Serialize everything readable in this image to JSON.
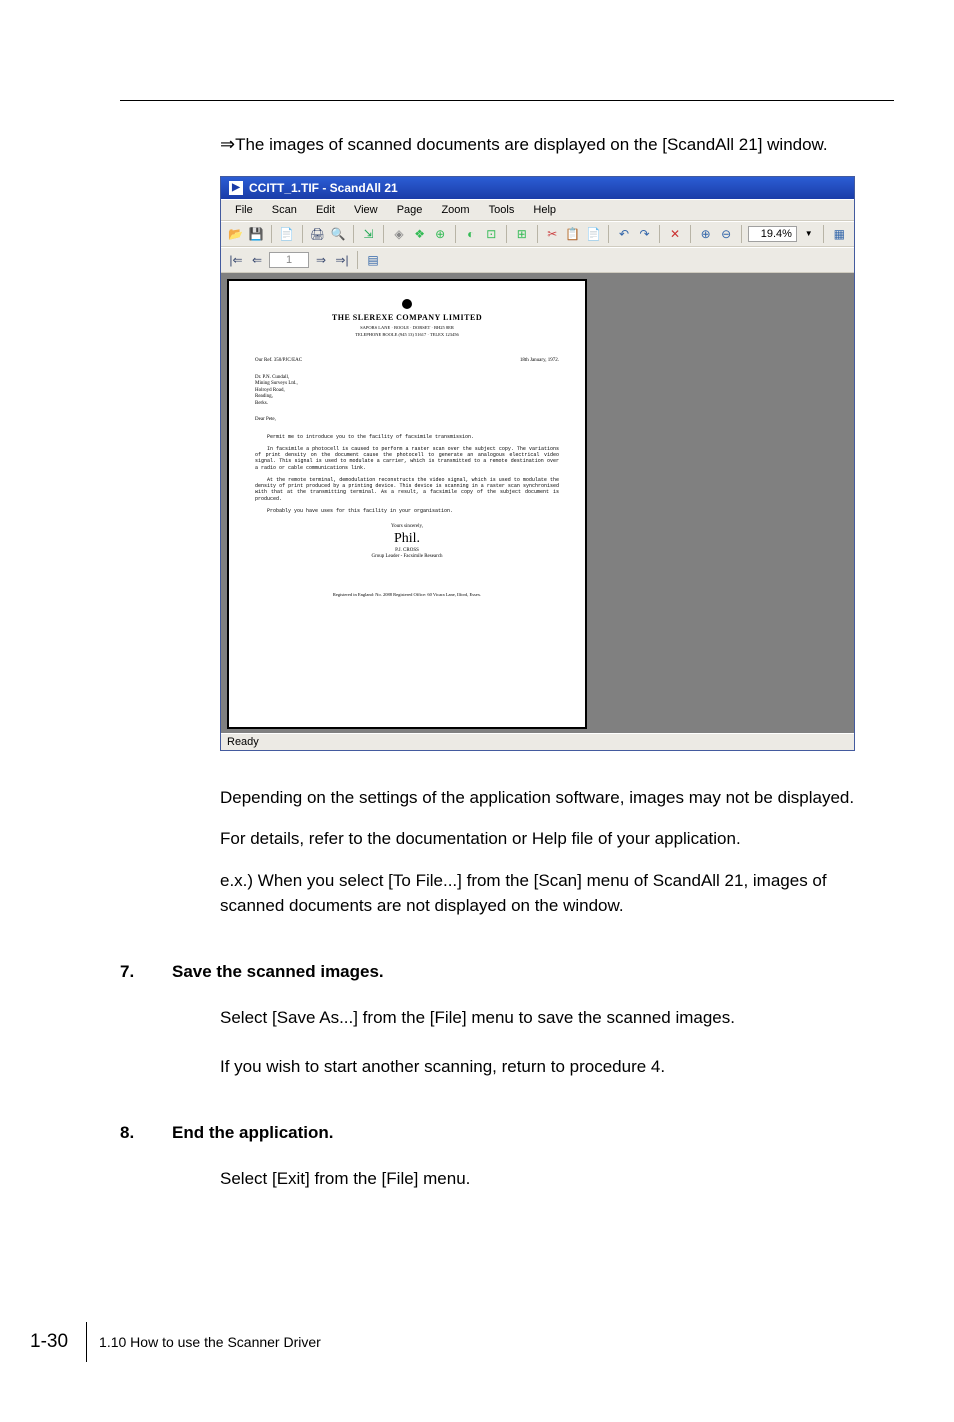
{
  "intro": "The images of scanned documents are displayed on the [ScandAll 21] window.",
  "arrow": "⇒",
  "app": {
    "title": "CCITT_1.TIF - ScandAll 21",
    "menus": [
      "File",
      "Scan",
      "Edit",
      "View",
      "Page",
      "Zoom",
      "Tools",
      "Help"
    ],
    "zoom": "19.4%",
    "page_num": "1",
    "status": "Ready",
    "doc": {
      "company": "THE SLEREXE COMPANY LIMITED",
      "sub1": "SAPORS LANE · BOOLE · DORSET · BH25 8ER",
      "sub2": "TELEPHONE BOOLE (945 13) 51617 · TELEX 123456",
      "ref": "Our Ref. 350/PJC/EAC",
      "date": "18th January, 1972.",
      "addr1": "Dr. P.N. Cundall,",
      "addr2": "Mining Surveys Ltd.,",
      "addr3": "Holroyd Road,",
      "addr4": "Reading,",
      "addr5": "Berks.",
      "saluation": "Dear Pete,",
      "p1": "Permit me to introduce you to the facility of facsimile transmission.",
      "p2": "In facsimile a photocell is caused to perform a raster scan over the subject copy. The variations of print density on the document cause the photocell to generate an analogous electrical video signal. This signal is used to modulate a carrier, which is transmitted to a remote destination over a radio or cable communications link.",
      "p3": "At the remote terminal, demodulation reconstructs the video signal, which is used to modulate the density of print produced by a printing device. This device is scanning in a raster scan synchronised with that at the transmitting terminal. As a result, a facsimile copy of the subject document is produced.",
      "p4": "Probably you have uses for this facility in your organisation.",
      "close": "Yours sincerely,",
      "sig": "Phil.",
      "name": "P.J. CROSS",
      "role": "Group Leader - Facsimile Research",
      "foot": "Registered in England: No. 2088    Registered Office: 60 Vicara Lane, Ilford, Essex."
    }
  },
  "para1": "Depending on the settings of the application software, images may not be displayed.",
  "para2": "For details, refer to the documentation or Help file of your application.",
  "para3": "e.x.) When you select [To File...] from the [Scan] menu of ScandAll 21, images of scanned documents are not displayed on the window.",
  "sec7_num": "7.",
  "sec7_title": "Save the scanned images.",
  "sec7_p1": "Select [Save As...] from the [File] menu to save the scanned images.",
  "sec7_p2": "If you wish to start another scanning, return to procedure 4.",
  "sec8_num": "8.",
  "sec8_title": "End the application.",
  "sec8_p1": "Select [Exit] from the [File] menu.",
  "footer_page": "1-30",
  "footer_label": "1.10 How to use the Scanner Driver"
}
